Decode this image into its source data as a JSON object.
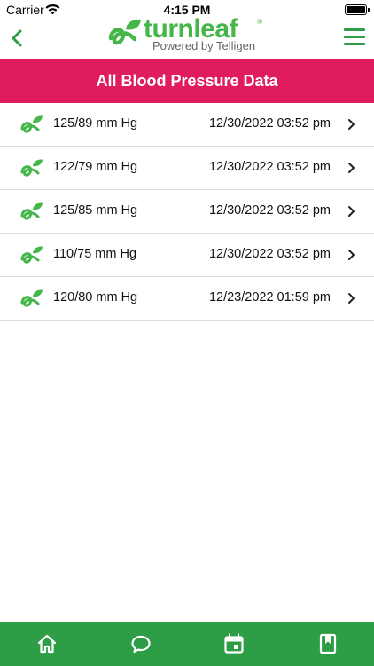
{
  "status_bar": {
    "carrier": "Carrier",
    "time": "4:15 PM"
  },
  "header": {
    "logo_text": "turnleaf",
    "logo_registered": "®",
    "logo_subtitle": "Powered by Telligen",
    "back_icon": "chevron-left-icon",
    "menu_icon": "hamburger-menu-icon"
  },
  "page": {
    "title": "All Blood Pressure Data"
  },
  "readings": [
    {
      "value": "125/89 mm Hg",
      "datetime": "12/30/2022 03:52 pm"
    },
    {
      "value": "122/79 mm Hg",
      "datetime": "12/30/2022 03:52 pm"
    },
    {
      "value": "125/85 mm Hg",
      "datetime": "12/30/2022 03:52 pm"
    },
    {
      "value": "110/75 mm Hg",
      "datetime": "12/30/2022 03:52 pm"
    },
    {
      "value": "120/80 mm Hg",
      "datetime": "12/23/2022 01:59 pm"
    }
  ],
  "tab_bar": {
    "tabs": [
      {
        "icon": "home-icon"
      },
      {
        "icon": "chat-bubble-icon"
      },
      {
        "icon": "calendar-icon"
      },
      {
        "icon": "bookmark-book-icon"
      }
    ]
  },
  "colors": {
    "brand_green": "#45b649",
    "header_pink": "#e01b5e",
    "tab_bar_green": "#2e9e46"
  }
}
